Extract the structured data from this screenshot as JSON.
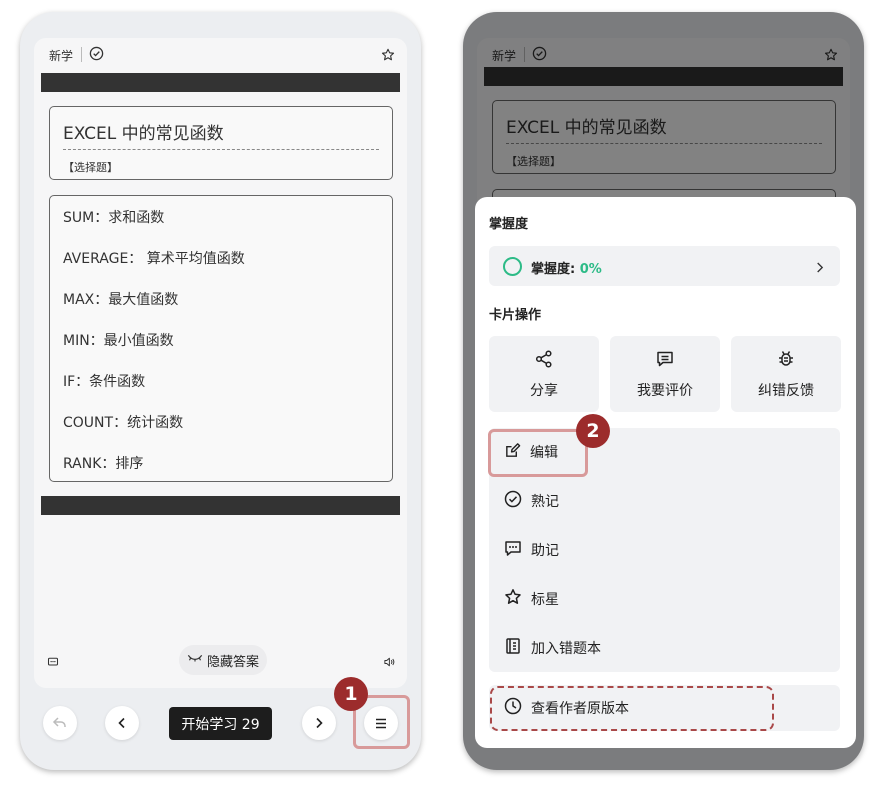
{
  "colors": {
    "accent_green": "#2dbb87",
    "badge_red": "#9c2c2c",
    "highlight_pink": "#d89a9a",
    "dashed_red": "#a94848"
  },
  "card": {
    "tag_new": "新学",
    "check_icon": "check-circle-icon",
    "star_icon": "star-icon",
    "question_title": "EXCEL 中的常见函数",
    "question_type": "【选择题】",
    "answers": [
      "SUM：求和函数",
      "AVERAGE： 算术平均值函数",
      "MAX：最大值函数",
      "MIN：最小值函数",
      "IF：条件函数",
      "COUNT：统计函数",
      "RANK：排序"
    ],
    "hide_answer_label": "隐藏答案"
  },
  "nav": {
    "start_label": "开始学习 29"
  },
  "badges": {
    "step1": "1",
    "step2": "2"
  },
  "sheet": {
    "mastery_section": "掌握度",
    "mastery_label": "掌握度: ",
    "mastery_value": "0%",
    "card_ops_section": "卡片操作",
    "ops": [
      {
        "label": "分享",
        "icon": "share-icon"
      },
      {
        "label": "我要评价",
        "icon": "comment-icon"
      },
      {
        "label": "纠错反馈",
        "icon": "bug-icon"
      }
    ],
    "menu": [
      {
        "label": "编辑",
        "icon": "edit-icon"
      },
      {
        "label": "熟记",
        "icon": "check-circle-icon"
      },
      {
        "label": "助记",
        "icon": "message-dots-icon"
      },
      {
        "label": "标星",
        "icon": "star-icon"
      },
      {
        "label": "加入错题本",
        "icon": "notebook-icon"
      }
    ],
    "history_label": "查看作者原版本"
  }
}
